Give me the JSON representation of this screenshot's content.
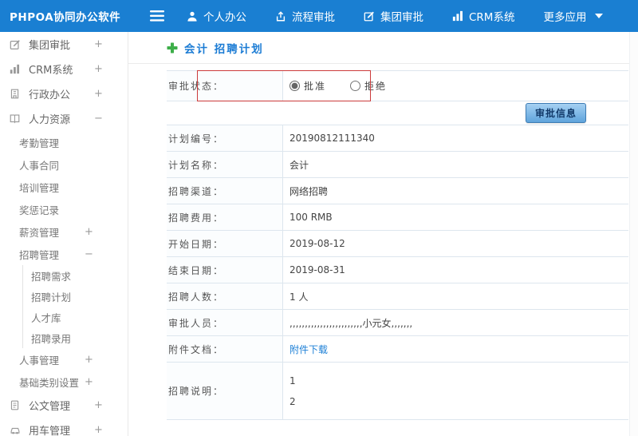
{
  "colors": {
    "header_bg": "#1a7fd2",
    "accent_blue": "#1a7bd4",
    "plus_green": "#3dae49",
    "annotation_red": "#cc3b3b",
    "link_blue": "#1c7fd6"
  },
  "header": {
    "logo": "PHPOA协同办公软件",
    "nav": [
      {
        "label": "个人办公",
        "icon": "user-icon"
      },
      {
        "label": "流程审批",
        "icon": "flow-icon"
      },
      {
        "label": "集团审批",
        "icon": "edit-icon"
      },
      {
        "label": "CRM系统",
        "icon": "chart-icon"
      },
      {
        "label": "更多应用",
        "icon": "caret-down-icon"
      }
    ]
  },
  "sidebar": {
    "items": [
      {
        "label": "集团审批",
        "toggle": "+",
        "level": 0,
        "icon": "edit-icon"
      },
      {
        "label": "CRM系统",
        "toggle": "+",
        "level": 0,
        "icon": "chart-icon"
      },
      {
        "label": "行政办公",
        "toggle": "+",
        "level": 0,
        "icon": "building-icon"
      },
      {
        "label": "人力资源",
        "toggle": "−",
        "level": 0,
        "icon": "book-icon"
      },
      {
        "label": "考勤管理",
        "toggle": "",
        "level": 1
      },
      {
        "label": "人事合同",
        "toggle": "",
        "level": 1
      },
      {
        "label": "培训管理",
        "toggle": "",
        "level": 1
      },
      {
        "label": "奖惩记录",
        "toggle": "",
        "level": 1
      },
      {
        "label": "薪资管理",
        "toggle": "+",
        "level": 1
      },
      {
        "label": "招聘管理",
        "toggle": "−",
        "level": 1
      },
      {
        "label": "招聘需求",
        "toggle": "",
        "level": 2
      },
      {
        "label": "招聘计划",
        "toggle": "",
        "level": 2
      },
      {
        "label": "人才库",
        "toggle": "",
        "level": 2
      },
      {
        "label": "招聘录用",
        "toggle": "",
        "level": 2
      },
      {
        "label": "人事管理",
        "toggle": "+",
        "level": 1
      },
      {
        "label": "基础类别设置",
        "toggle": "+",
        "level": 1
      },
      {
        "label": "公文管理",
        "toggle": "+",
        "level": 0,
        "icon": "document-icon"
      },
      {
        "label": "用车管理",
        "toggle": "+",
        "level": 0,
        "icon": "car-icon"
      }
    ]
  },
  "main": {
    "title": "会计 招聘计划",
    "status_row": {
      "label": "审批状态：",
      "options": [
        {
          "label": "批准",
          "selected": true
        },
        {
          "label": "拒绝",
          "selected": false
        }
      ]
    },
    "approve_button": "审批信息",
    "rows": [
      {
        "label": "计划编号：",
        "value": "20190812111340"
      },
      {
        "label": "计划名称：",
        "value": "会计"
      },
      {
        "label": "招聘渠道：",
        "value": "网络招聘"
      },
      {
        "label": "招聘费用：",
        "value": "100 RMB"
      },
      {
        "label": "开始日期：",
        "value": "2019-08-12"
      },
      {
        "label": "结束日期：",
        "value": "2019-08-31"
      },
      {
        "label": "招聘人数：",
        "value": "1 人"
      },
      {
        "label": "审批人员：",
        "value": ",,,,,,,,,,,,,,,,,,,,,,,,小元女,,,,,,,"
      },
      {
        "label": "附件文档：",
        "value": "附件下载"
      },
      {
        "label": "招聘说明：",
        "value": "1\n2"
      }
    ]
  }
}
